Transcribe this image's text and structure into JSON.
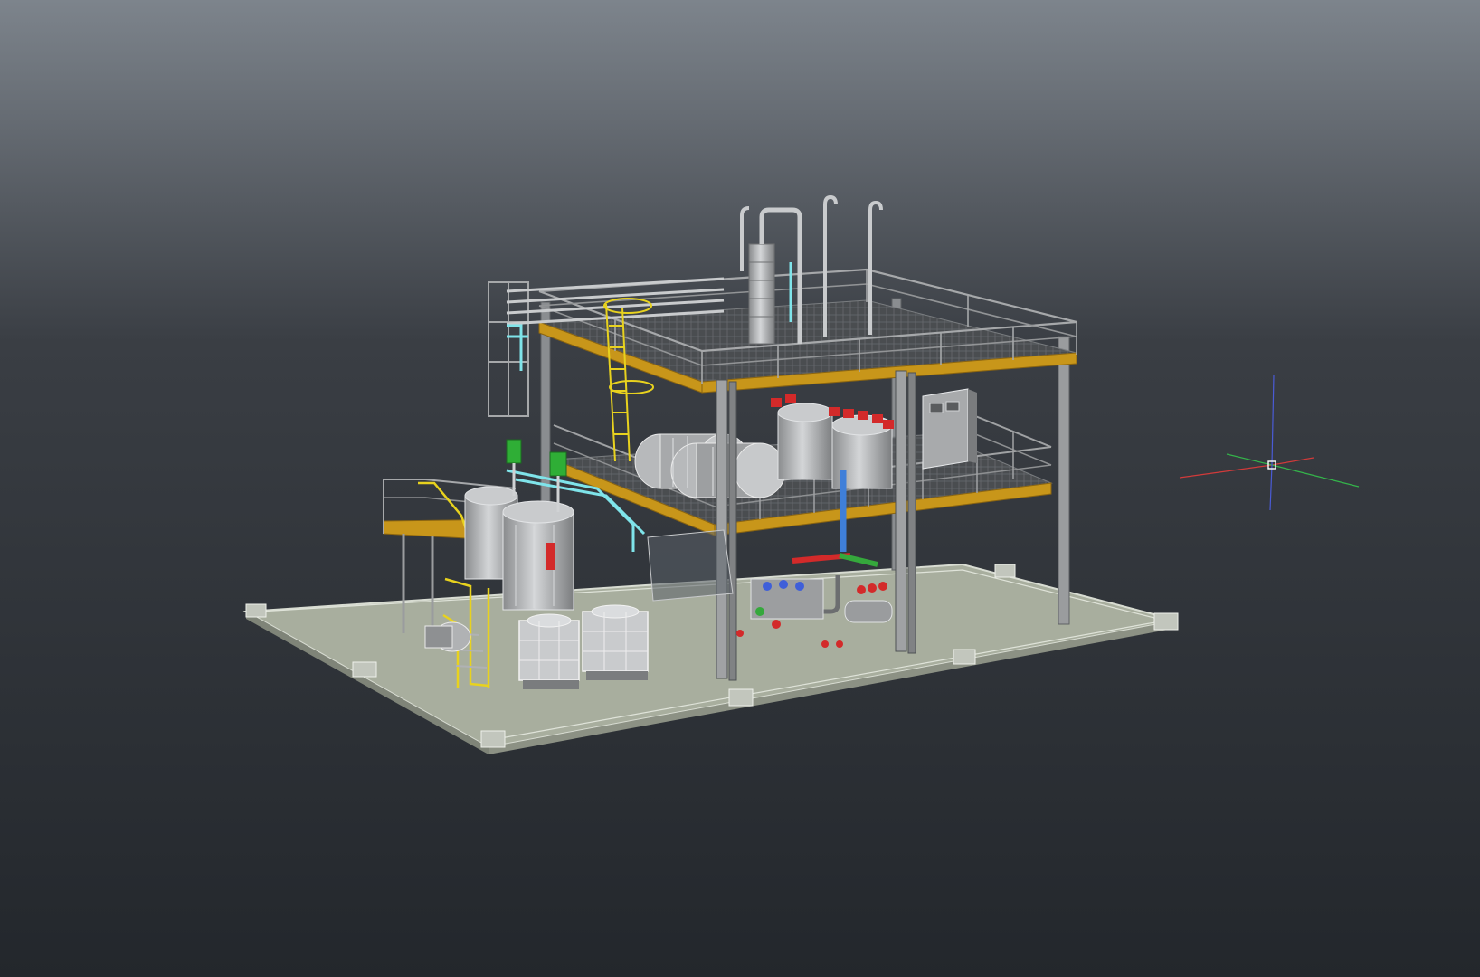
{
  "viewport": {
    "background_top": "#7d848c",
    "background_mid": "#3a3e44",
    "background_bottom": "#23272c"
  },
  "model": {
    "steel_color": "#9a9c9e",
    "steel_dark": "#5e6164",
    "beam_accent": "#c8961a",
    "handrail_safety": "#e8d21e",
    "floor_color": "#a8ae9e",
    "pipe_cyan": "#7fe4ea",
    "pipe_blue": "#3f7fd9",
    "pipe_red": "#d32a2a",
    "pipe_green": "#35a83c",
    "vessel_color": "#b7b9bb",
    "motor_green": "#2fae36"
  },
  "ucs": {
    "x_axis_color": "#d23a3a",
    "y_axis_color": "#34b34a",
    "z_axis_color": "#4a5bd6"
  }
}
